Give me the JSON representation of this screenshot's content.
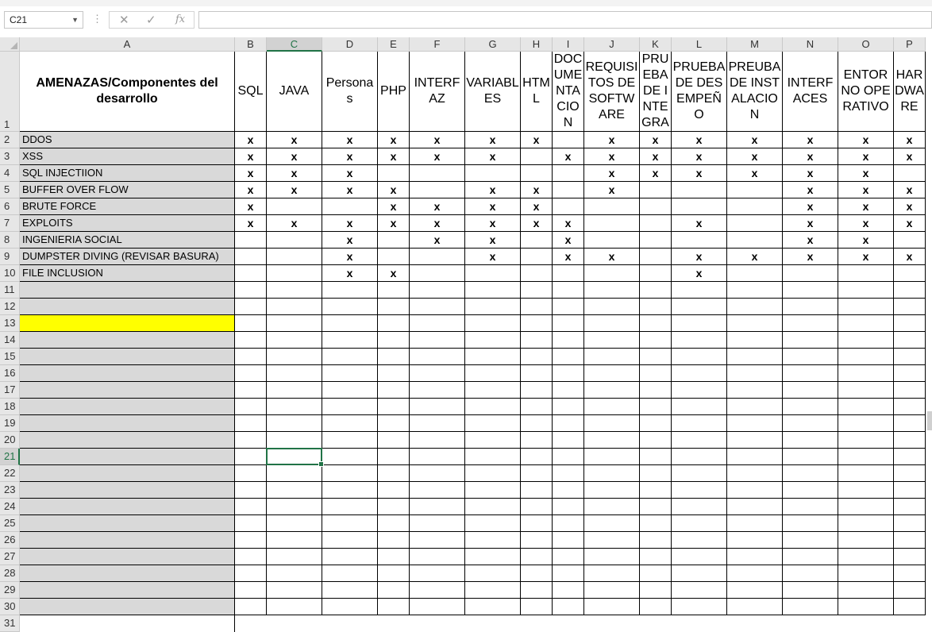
{
  "formula_bar": {
    "name_box": "C21",
    "function_icon": "fx",
    "cancel_icon": "close-icon",
    "confirm_icon": "check-icon",
    "formula": ""
  },
  "sheet": {
    "columns": [
      "A",
      "B",
      "C",
      "D",
      "E",
      "F",
      "G",
      "H",
      "I",
      "J",
      "K",
      "L",
      "M",
      "N",
      "O",
      "P"
    ],
    "selected_column": "C",
    "selected_row": 21,
    "row_numbers": [
      1,
      2,
      3,
      4,
      5,
      6,
      7,
      8,
      9,
      10,
      11,
      12,
      13,
      14,
      15,
      16,
      17,
      18,
      19,
      20,
      21,
      22,
      23,
      24,
      25,
      26,
      27,
      28,
      29,
      30,
      31
    ],
    "header_row": {
      "title": "AMENAZAS/Componentes del desarrollo",
      "components": [
        "SQL",
        "JAVA",
        "Personas",
        "PHP",
        "INTERFAZ",
        "VARIABLES",
        "HTML",
        "DOCUMENTACION",
        "REQUISITOS DE SOFTWARE",
        "PRUEBA DE INTEGRA",
        "PRUEBA DE DESEMPEÑO",
        "PREUBA DE INSTALACION",
        "INTERFACES",
        "ENTORNO OPERATIVO",
        "HARDWARE"
      ]
    },
    "threats": [
      {
        "name": "DDOS",
        "marks": [
          "x",
          "x",
          "x",
          "x",
          "x",
          "x",
          "x",
          "",
          "x",
          "x",
          "x",
          "x",
          "x",
          "x",
          "x"
        ]
      },
      {
        "name": "XSS",
        "marks": [
          "x",
          "x",
          "x",
          "x",
          "x",
          "x",
          "",
          "x",
          "x",
          "x",
          "x",
          "x",
          "x",
          "x",
          "x"
        ]
      },
      {
        "name": "SQL INJECTIION",
        "marks": [
          "x",
          "x",
          "x",
          "",
          "",
          "",
          "",
          "",
          "x",
          "x",
          "x",
          "x",
          "x",
          "x",
          ""
        ]
      },
      {
        "name": "BUFFER OVER FLOW",
        "marks": [
          "x",
          "x",
          "x",
          "x",
          "",
          "x",
          "x",
          "",
          "x",
          "",
          "",
          "",
          "x",
          "x",
          "x"
        ]
      },
      {
        "name": "BRUTE FORCE",
        "marks": [
          "x",
          "",
          "",
          "x",
          "x",
          "x",
          "x",
          "",
          "",
          "",
          "",
          "",
          "x",
          "x",
          "x"
        ]
      },
      {
        "name": "EXPLOITS",
        "marks": [
          "x",
          "x",
          "x",
          "x",
          "x",
          "x",
          "x",
          "x",
          "",
          "",
          "x",
          "",
          "x",
          "x",
          "x"
        ]
      },
      {
        "name": "INGENIERIA SOCIAL",
        "marks": [
          "",
          "",
          "x",
          "",
          "x",
          "x",
          "",
          "x",
          "",
          "",
          "",
          "",
          "x",
          "x",
          ""
        ]
      },
      {
        "name": "DUMPSTER DIVING (REVISAR BASURA)",
        "marks": [
          "",
          "",
          "x",
          "",
          "",
          "x",
          "",
          "x",
          "x",
          "",
          "x",
          "x",
          "x",
          "x",
          "x"
        ]
      },
      {
        "name": "FILE INCLUSION",
        "marks": [
          "",
          "",
          "x",
          "x",
          "",
          "",
          "",
          "",
          "",
          "",
          "x",
          "",
          "",
          "",
          ""
        ]
      }
    ],
    "highlight_row": 13,
    "highlight_color": "#ffff00",
    "accent_color": "#217346"
  }
}
